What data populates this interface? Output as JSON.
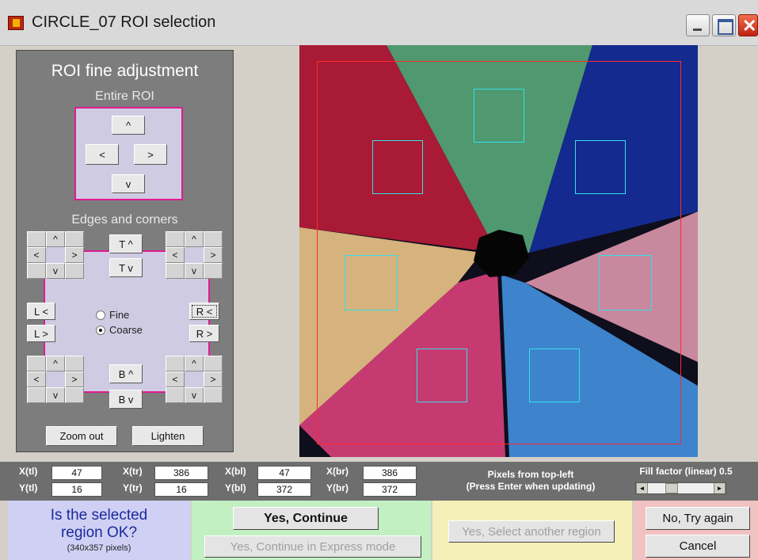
{
  "window": {
    "title": "CIRCLE_07 ROI selection"
  },
  "panel": {
    "title": "ROI fine adjustment",
    "entire_roi_label": "Entire ROI",
    "edges_label": "Edges and corners",
    "up": "^",
    "down": "v",
    "left": "<",
    "right": ">",
    "top_up": "T ^",
    "top_down": "T v",
    "left_left": "L <",
    "left_right": "L >",
    "right_left": "R <",
    "right_right": "R >",
    "bottom_up": "B ^",
    "bottom_down": "B v",
    "fine": "Fine",
    "coarse": "Coarse",
    "zoom_out": "Zoom out",
    "lighten": "Lighten"
  },
  "coords": {
    "xtl_label": "X(tl)",
    "ytl_label": "Y(tl)",
    "xtr_label": "X(tr)",
    "ytr_label": "Y(tr)",
    "xbl_label": "X(bl)",
    "ybl_label": "Y(bl)",
    "xbr_label": "X(br)",
    "ybr_label": "Y(br)",
    "xtl": "47",
    "ytl": "16",
    "xtr": "386",
    "ytr": "16",
    "xbl": "47",
    "ybl": "372",
    "xbr": "386",
    "ybr": "372",
    "info_line1": "Pixels from top-left",
    "info_line2": "(Press Enter when updating)",
    "fill_factor": "Fill factor (linear) 0.5",
    "slider_left": "◄",
    "slider_right": "►"
  },
  "bottom": {
    "question_line1": "Is the selected",
    "question_line2": "region OK?",
    "size": "(340x357 pixels)",
    "yes_continue": "Yes, Continue",
    "yes_express": "Yes, Continue in Express mode",
    "yes_select_another": "Yes, Select another region",
    "no_try_again": "No, Try again",
    "cancel": "Cancel"
  },
  "fill_factor_value": 0.5,
  "colors": {
    "roi_border": "#ff2a2a",
    "patch_border": "#35e0e8",
    "panel_bg": "#7d7d7d",
    "lavender": "#cfcbe2",
    "magenta_border": "#e01a90"
  }
}
